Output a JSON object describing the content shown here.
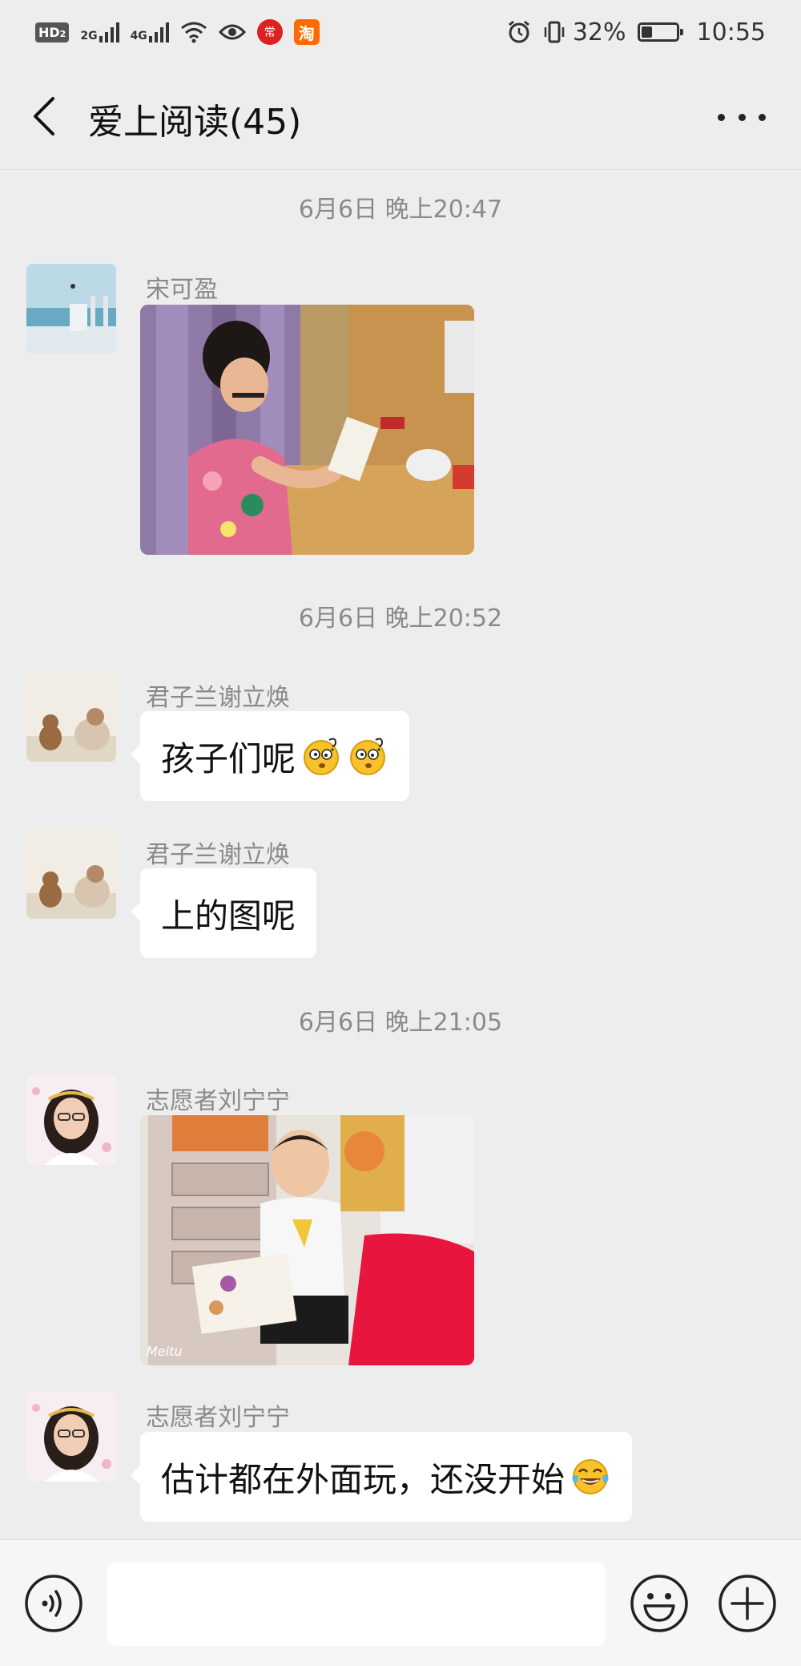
{
  "status_bar": {
    "hd": "HD",
    "hd_sub": "2",
    "net1": "2G",
    "net2": "4G",
    "app1": "常",
    "app2": "淘",
    "battery_text": "32%",
    "battery_level": 0.32,
    "time": "10:55"
  },
  "header": {
    "title": "爱上阅读(45)"
  },
  "messages": {
    "ts1": "6月6日 晚上20:47",
    "m1_sender": "宋可盈",
    "ts2": "6月6日 晚上20:52",
    "m2_sender": "君子兰谢立焕",
    "m2_text": "孩子们呢",
    "m3_sender": "君子兰谢立焕",
    "m3_text": "上的图呢",
    "ts3": "6月6日 晚上21:05",
    "m4_sender": "志愿者刘宁宁",
    "m4_watermark": "Meitu",
    "m5_sender": "志愿者刘宁宁",
    "m5_text": "估计都在外面玩，还没开始"
  },
  "colors": {
    "background": "#ededed",
    "bubble": "#ffffff",
    "meta_text": "#8a8a8a"
  },
  "icons": [
    "back-arrow-icon",
    "more-icon",
    "voice-icon",
    "emoji-icon",
    "plus-icon",
    "dizzy-face-emoji",
    "laughing-tears-emoji",
    "alarm-icon",
    "vibrate-icon",
    "wifi-icon",
    "eye-icon",
    "battery-icon"
  ]
}
